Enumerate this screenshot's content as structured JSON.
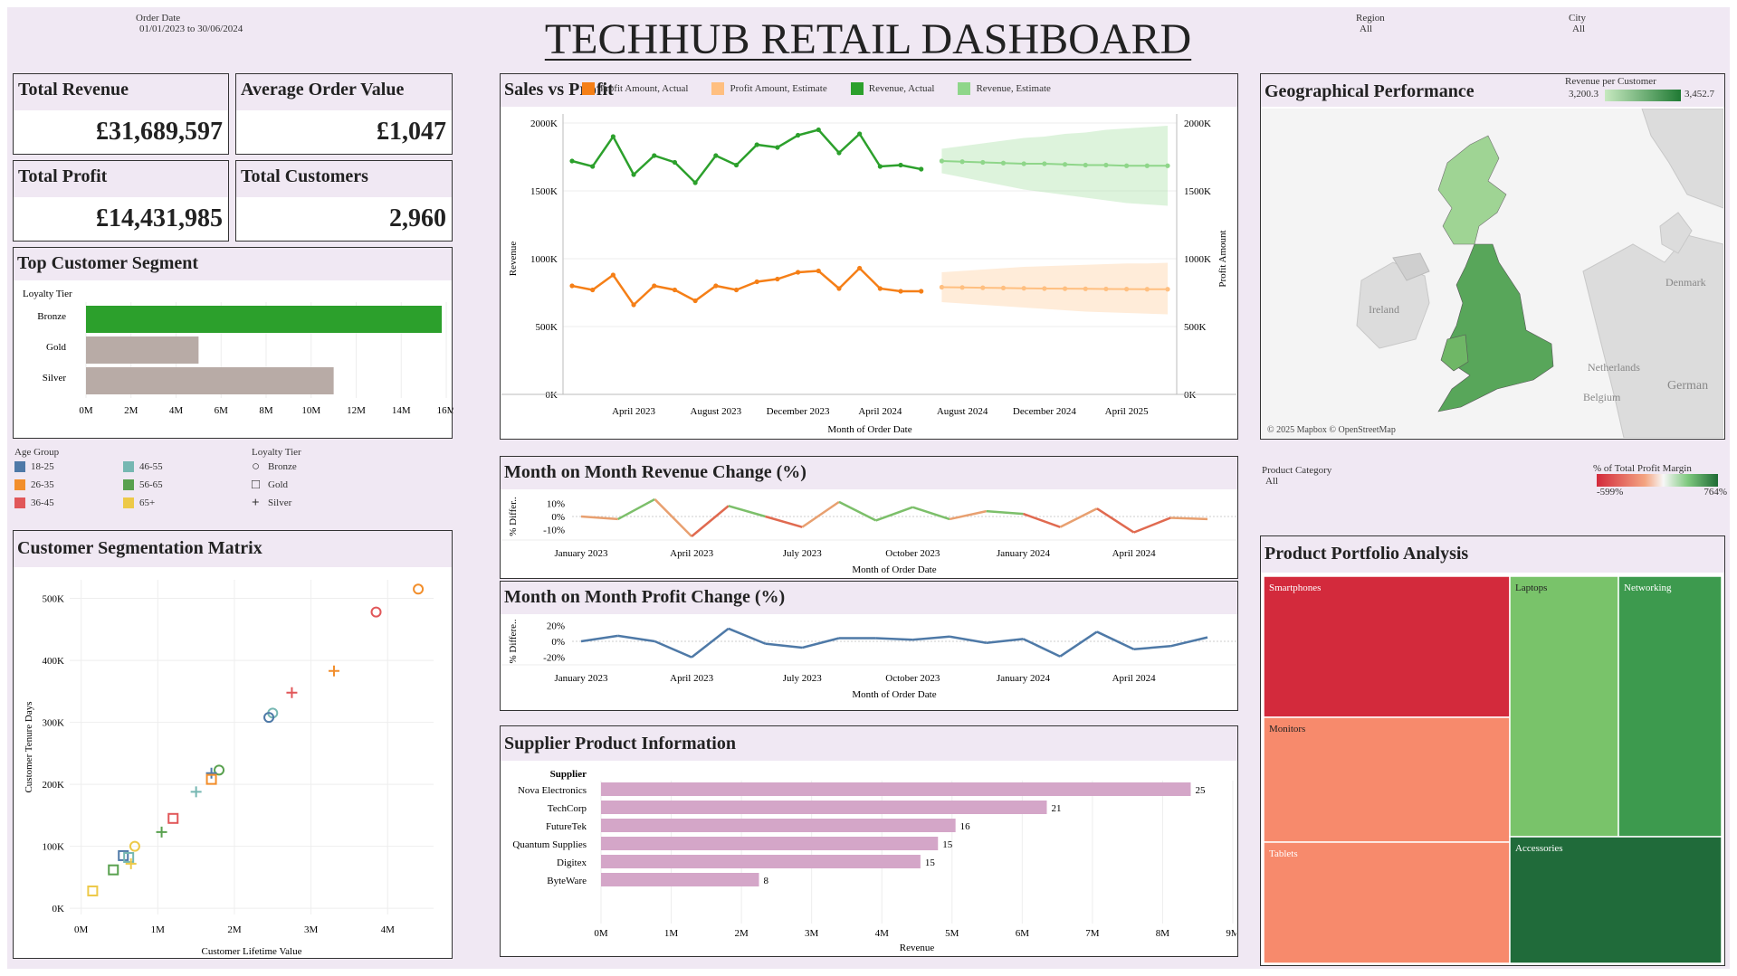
{
  "header": {
    "title": "TECHHUB RETAIL DASHBOARD"
  },
  "filters": {
    "order_date": {
      "label": "Order Date",
      "value": "01/01/2023 to 30/06/2024"
    },
    "region": {
      "label": "Region",
      "value": "All"
    },
    "city": {
      "label": "City",
      "value": "All"
    },
    "product_category": {
      "label": "Product Category",
      "value": "All"
    }
  },
  "kpis": {
    "total_revenue": {
      "label": "Total Revenue",
      "value": "£31,689,597"
    },
    "avg_order_value": {
      "label": "Average Order Value",
      "value": "£1,047"
    },
    "total_profit": {
      "label": "Total Profit",
      "value": "£14,431,985"
    },
    "total_customers": {
      "label": "Total Customers",
      "value": "2,960"
    }
  },
  "colors": {
    "green": "#2ca02c",
    "green_light": "#8fd68a",
    "orange": "#f57f17",
    "orange_light": "#ffbf80",
    "gray_bar": "#b8aba6",
    "blue_line": "#4e79a7",
    "pink_bar": "#d4a6c8",
    "bg": "#f0e8f3"
  },
  "top_segment": {
    "title": "Top Customer Segment",
    "dim_label": "Loyalty Tier",
    "chart_data": {
      "type": "bar",
      "categories": [
        "Bronze",
        "Gold",
        "Silver"
      ],
      "values": [
        15800000,
        5000000,
        11000000
      ],
      "xlim": [
        0,
        16000000
      ],
      "ticks": [
        "0M",
        "2M",
        "4M",
        "6M",
        "8M",
        "10M",
        "12M",
        "14M",
        "16M"
      ]
    }
  },
  "age_legend": {
    "title": "Age Group",
    "items": [
      {
        "label": "18-25",
        "color": "#4e79a7"
      },
      {
        "label": "46-55",
        "color": "#76b7b2"
      },
      {
        "label": "26-35",
        "color": "#f28e2b"
      },
      {
        "label": "56-65",
        "color": "#59a14f"
      },
      {
        "label": "36-45",
        "color": "#e15759"
      },
      {
        "label": "65+",
        "color": "#edc948"
      }
    ]
  },
  "tier_legend": {
    "title": "Loyalty Tier",
    "items": [
      {
        "label": "Bronze",
        "shape": "circle-icon"
      },
      {
        "label": "Gold",
        "shape": "square-icon"
      },
      {
        "label": "Silver",
        "shape": "plus-icon"
      }
    ]
  },
  "seg_matrix": {
    "title": "Customer Segmentation Matrix",
    "xlabel": "Customer Lifetime Value",
    "ylabel": "Customer Tenure Days",
    "xticks": [
      "0M",
      "1M",
      "2M",
      "3M",
      "4M"
    ],
    "yticks": [
      "0K",
      "100K",
      "200K",
      "300K",
      "400K",
      "500K"
    ],
    "chart_data": {
      "type": "scatter",
      "xlim": [
        -150000,
        4600000
      ],
      "ylim": [
        -10000,
        530000
      ],
      "points": [
        {
          "x": 4400000,
          "y": 515000,
          "age": "26-35",
          "tier": "Bronze"
        },
        {
          "x": 3850000,
          "y": 478000,
          "age": "36-45",
          "tier": "Bronze"
        },
        {
          "x": 3300000,
          "y": 383000,
          "age": "26-35",
          "tier": "Silver"
        },
        {
          "x": 2750000,
          "y": 348000,
          "age": "36-45",
          "tier": "Silver"
        },
        {
          "x": 2500000,
          "y": 315000,
          "age": "46-55",
          "tier": "Bronze"
        },
        {
          "x": 2450000,
          "y": 308000,
          "age": "18-25",
          "tier": "Bronze"
        },
        {
          "x": 1800000,
          "y": 223000,
          "age": "56-65",
          "tier": "Bronze"
        },
        {
          "x": 1700000,
          "y": 218000,
          "age": "18-25",
          "tier": "Silver"
        },
        {
          "x": 1700000,
          "y": 208000,
          "age": "26-35",
          "tier": "Gold"
        },
        {
          "x": 1500000,
          "y": 188000,
          "age": "46-55",
          "tier": "Silver"
        },
        {
          "x": 1200000,
          "y": 145000,
          "age": "36-45",
          "tier": "Gold"
        },
        {
          "x": 1050000,
          "y": 123000,
          "age": "56-65",
          "tier": "Silver"
        },
        {
          "x": 700000,
          "y": 100000,
          "age": "65+",
          "tier": "Bronze"
        },
        {
          "x": 550000,
          "y": 85000,
          "age": "18-25",
          "tier": "Gold"
        },
        {
          "x": 620000,
          "y": 82000,
          "age": "46-55",
          "tier": "Gold"
        },
        {
          "x": 650000,
          "y": 72000,
          "age": "65+",
          "tier": "Silver"
        },
        {
          "x": 420000,
          "y": 62000,
          "age": "56-65",
          "tier": "Gold"
        },
        {
          "x": 150000,
          "y": 28000,
          "age": "65+",
          "tier": "Gold"
        }
      ]
    }
  },
  "sales_profit": {
    "title": "Sales vs Profit",
    "legend": [
      {
        "label": "Profit Amount, Actual",
        "color": "#f57f17"
      },
      {
        "label": "Profit Amount, Estimate",
        "color": "#ffbf80"
      },
      {
        "label": "Revenue, Actual",
        "color": "#2ca02c"
      },
      {
        "label": "Revenue, Estimate",
        "color": "#8fd68a"
      }
    ],
    "ylabel_left": "Revenue",
    "ylabel_right": "Profit Amount",
    "xlabel": "Month of Order Date",
    "yticks": [
      "0K",
      "500K",
      "1000K",
      "1500K",
      "2000K"
    ],
    "xticks": [
      "April 2023",
      "August 2023",
      "December 2023",
      "April 2024",
      "August 2024",
      "December 2024",
      "April 2025"
    ],
    "chart_data": {
      "type": "line",
      "ylim": [
        0,
        2000000
      ],
      "x_start": "2023-01",
      "x_end": "2025-06",
      "revenue_actual": [
        1720000,
        1680000,
        1900000,
        1620000,
        1760000,
        1710000,
        1560000,
        1760000,
        1690000,
        1840000,
        1820000,
        1910000,
        1950000,
        1780000,
        1920000,
        1680000,
        1690000,
        1660000
      ],
      "profit_actual": [
        800000,
        770000,
        880000,
        660000,
        800000,
        770000,
        690000,
        800000,
        770000,
        830000,
        850000,
        900000,
        910000,
        780000,
        930000,
        780000,
        760000,
        760000
      ],
      "revenue_estimate": [
        1720000,
        1715000,
        1710000,
        1705000,
        1700000,
        1700000,
        1695000,
        1690000,
        1690000,
        1685000,
        1685000,
        1685000
      ],
      "revenue_est_upper": [
        1810000,
        1830000,
        1850000,
        1870000,
        1890000,
        1900000,
        1920000,
        1930000,
        1950000,
        1960000,
        1970000,
        1980000
      ],
      "revenue_est_lower": [
        1630000,
        1600000,
        1570000,
        1540000,
        1510000,
        1490000,
        1470000,
        1450000,
        1430000,
        1410000,
        1400000,
        1390000
      ],
      "profit_estimate": [
        790000,
        788000,
        786000,
        784000,
        782000,
        780000,
        779000,
        778000,
        777000,
        776000,
        775000,
        775000
      ],
      "profit_est_upper": [
        900000,
        910000,
        920000,
        930000,
        940000,
        945000,
        950000,
        955000,
        960000,
        965000,
        965000,
        970000
      ],
      "profit_est_lower": [
        680000,
        670000,
        660000,
        650000,
        640000,
        630000,
        620000,
        610000,
        605000,
        600000,
        595000,
        590000
      ]
    }
  },
  "geo": {
    "title": "Geographical Performance",
    "legend_title": "Revenue per Customer",
    "legend_min": "3,200.3",
    "legend_max": "3,452.7",
    "labels": {
      "ireland": "Ireland",
      "netherlands": "Netherlands",
      "belgium": "Belgium",
      "denmark": "Denmark",
      "germany": "German"
    },
    "credit": "© 2025 Mapbox © OpenStreetMap"
  },
  "mom_revenue": {
    "title": "Month on Month Revenue Change (%)",
    "ylabel": "% Differ..",
    "xlabel": "Month of Order Date",
    "yticks": [
      "10%",
      "0%",
      "-10%"
    ],
    "xticks": [
      "January 2023",
      "April 2023",
      "July 2023",
      "October 2023",
      "January 2024",
      "April 2024"
    ],
    "chart_data": {
      "type": "line",
      "ylim": [
        -15,
        15
      ],
      "values": [
        0,
        -2,
        13,
        -15,
        8,
        0,
        -8,
        11,
        -3,
        7,
        -2,
        4,
        2,
        -8,
        6,
        -12,
        -1,
        -2
      ]
    }
  },
  "mom_profit": {
    "title": "Month on Month Profit Change (%)",
    "ylabel": "% Differe..",
    "xlabel": "Month of Order Date",
    "yticks": [
      "20%",
      "0%",
      "-20%"
    ],
    "xticks": [
      "January 2023",
      "April 2023",
      "July 2023",
      "October 2023",
      "January 2024",
      "April 2024"
    ],
    "chart_data": {
      "type": "line",
      "ylim": [
        -25,
        25
      ],
      "values": [
        0,
        7,
        0,
        -20,
        16,
        -3,
        -8,
        4,
        4,
        2,
        6,
        -2,
        3,
        -19,
        12,
        -10,
        -6,
        5
      ]
    }
  },
  "supplier": {
    "title": "Supplier Product Information",
    "dim_label": "Supplier",
    "xlabel": "Revenue",
    "xticks": [
      "0M",
      "1M",
      "2M",
      "3M",
      "4M",
      "5M",
      "6M",
      "7M",
      "8M",
      "9M"
    ],
    "chart_data": {
      "type": "bar",
      "xlim": [
        0,
        9000000
      ],
      "categories": [
        "Nova Electronics",
        "TechCorp",
        "FutureTek",
        "Quantum Supplies",
        "Digitex",
        "ByteWare"
      ],
      "values": [
        8400000,
        6350000,
        5050000,
        4800000,
        4550000,
        2250000
      ],
      "labels": [
        "25",
        "21",
        "16",
        "15",
        "15",
        "8"
      ]
    }
  },
  "treemap": {
    "title": "Product Portfolio Analysis",
    "legend_title": "% of Total Profit Margin",
    "legend_min": "-599%",
    "legend_max": "764%",
    "chart_data": {
      "type": "treemap",
      "items": [
        {
          "label": "Smartphones",
          "color": "#d32a3c"
        },
        {
          "label": "Monitors",
          "color": "#f78a6c"
        },
        {
          "label": "Tablets",
          "color": "#f78a6c"
        },
        {
          "label": "Laptops",
          "color": "#79c36a"
        },
        {
          "label": "Networking",
          "color": "#3d9a4e"
        },
        {
          "label": "Accessories",
          "color": "#206b3a"
        }
      ]
    }
  }
}
